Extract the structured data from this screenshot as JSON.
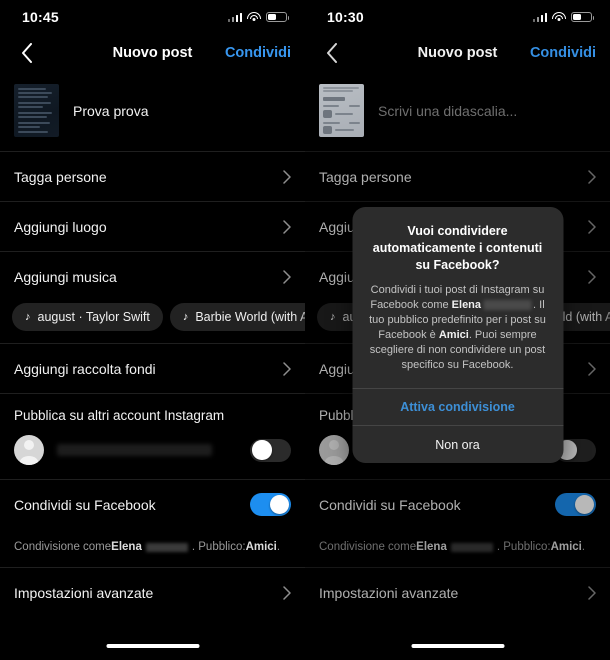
{
  "screens": [
    {
      "id": "left",
      "status": {
        "time": "10:45",
        "battery_level": 45,
        "signal_icon": "cellular-signal-icon",
        "wifi_icon": "wifi-icon",
        "battery_icon": "battery-icon"
      },
      "nav": {
        "back_icon": "chevron-left-icon",
        "title": "Nuovo post",
        "action": "Condividi"
      },
      "caption": {
        "text": "Prova prova",
        "is_placeholder": false,
        "thumb": "post-thumbnail-dark"
      },
      "rows": [
        {
          "label": "Tagga persone",
          "chevron": "chevron-right-icon"
        },
        {
          "label": "Aggiungi luogo",
          "chevron": "chevron-right-icon"
        },
        {
          "label": "Aggiungi musica",
          "chevron": "chevron-right-icon"
        },
        {
          "label": "Aggiungi raccolta fondi",
          "chevron": "chevron-right-icon"
        }
      ],
      "music_chips": [
        {
          "icon": "music-note-icon",
          "label": "august · Taylor Swift"
        },
        {
          "icon": "music-note-icon",
          "label": "Barbie World (with Aqua"
        }
      ],
      "section_header": "Pubblica su altri account Instagram",
      "account": {
        "avatar": "default-avatar-icon",
        "username_redacted": true,
        "toggle_state": "off"
      },
      "facebook_row": {
        "label": "Condividi su Facebook",
        "toggle_state": "on"
      },
      "footnote": {
        "prefix": "Condivisione come ",
        "name": "Elena",
        "redacted": true,
        "middle": ". Pubblico: ",
        "audience": "Amici",
        "suffix": "."
      },
      "advanced_row": {
        "label": "Impostazioni avanzate",
        "chevron": "chevron-right-icon"
      },
      "home_indicator": "home-indicator"
    },
    {
      "id": "right",
      "status": {
        "time": "10:30",
        "battery_level": 45,
        "signal_icon": "cellular-signal-icon",
        "wifi_icon": "wifi-icon",
        "battery_icon": "battery-icon"
      },
      "nav": {
        "back_icon": "chevron-left-icon",
        "title": "Nuovo post",
        "action": "Condividi"
      },
      "caption": {
        "text": "Scrivi una didascalia...",
        "is_placeholder": true,
        "thumb": "post-thumbnail-light"
      },
      "rows": [
        {
          "label": "Tagga persone",
          "chevron": "chevron-right-icon"
        },
        {
          "label": "Aggiungi luogo",
          "chevron": "chevron-right-icon"
        },
        {
          "label": "Aggiungi musica",
          "chevron": "chevron-right-icon"
        },
        {
          "label": "Aggiungi raccolta fondi",
          "chevron": "chevron-right-icon"
        }
      ],
      "music_chips": [
        {
          "icon": "music-note-icon",
          "label": "august · Taylor Swift"
        },
        {
          "icon": "music-note-icon",
          "label": "Barbie World (with Aqua"
        }
      ],
      "section_header": "Pubblica su altri account Instagram",
      "account": {
        "avatar": "default-avatar-icon",
        "username_redacted": true,
        "toggle_state": "off"
      },
      "facebook_row": {
        "label": "Condividi su Facebook",
        "toggle_state": "on"
      },
      "footnote": {
        "prefix": "Condivisione come ",
        "name": "Elena",
        "redacted": true,
        "middle": ". Pubblico: ",
        "audience": "Amici",
        "suffix": "."
      },
      "advanced_row": {
        "label": "Impostazioni avanzate",
        "chevron": "chevron-right-icon"
      },
      "home_indicator": "home-indicator"
    }
  ],
  "dialog": {
    "title": "Vuoi condividere automaticamente i contenuti su Facebook?",
    "message_part1": "Condividi i tuoi post di Instagram su Facebook come ",
    "message_name": "Elena",
    "message_part2": ". Il tuo pubblico predefinito per i post su Facebook è ",
    "message_audience": "Amici",
    "message_part3": ". Puoi sempre scegliere di non condividere un post specifico su Facebook.",
    "primary_button": "Attiva condivisione",
    "secondary_button": "Non ora"
  },
  "colors": {
    "background": "#000000",
    "accent_blue": "#3897f0",
    "toggle_on": "#1d8ef0",
    "dialog_bg": "#2c2c2c",
    "dialog_primary": "#3d8fd6",
    "divider": "#1f1f1f",
    "secondary_text": "#9a9a9a"
  }
}
